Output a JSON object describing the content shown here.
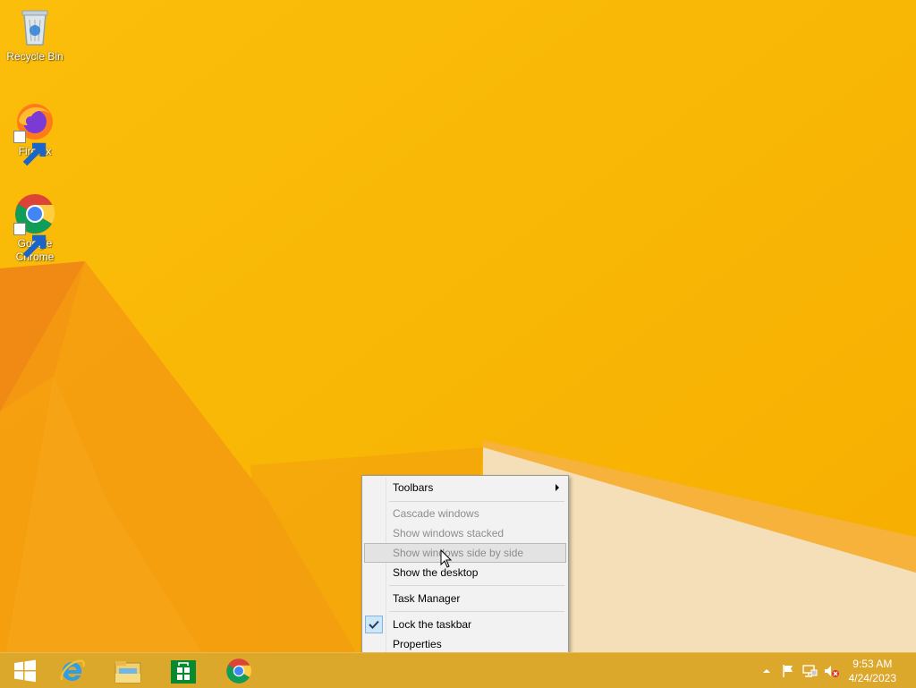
{
  "desktop": {
    "icons": [
      {
        "label": "Recycle Bin"
      },
      {
        "label": "Firefox"
      },
      {
        "label": "Google Chrome"
      }
    ]
  },
  "context_menu": {
    "items": [
      {
        "label": "Toolbars",
        "enabled": true,
        "submenu": true
      },
      {
        "label": "Cascade windows",
        "enabled": false
      },
      {
        "label": "Show windows stacked",
        "enabled": false
      },
      {
        "label": "Show windows side by side",
        "enabled": false,
        "hovered": true
      },
      {
        "label": "Show the desktop",
        "enabled": true
      },
      {
        "label": "Task Manager",
        "enabled": true
      },
      {
        "label": "Lock the taskbar",
        "enabled": true,
        "checked": true
      },
      {
        "label": "Properties",
        "enabled": true
      }
    ]
  },
  "taskbar": {
    "pinned": [
      {
        "icon": "start-icon"
      },
      {
        "icon": "internet-explorer-icon"
      },
      {
        "icon": "file-explorer-icon"
      },
      {
        "icon": "store-icon"
      },
      {
        "icon": "chrome-icon"
      }
    ],
    "tray": {
      "icons": [
        "show-hidden-icons-arrow",
        "action-center-flag-icon",
        "network-icon",
        "volume-muted-icon"
      ]
    },
    "clock": {
      "time": "9:53 AM",
      "date": "4/24/2023"
    }
  },
  "colors": {
    "wallpaper": "#f7b500",
    "accent_orange": "#ef8a12",
    "taskbar": "#dca82c"
  }
}
